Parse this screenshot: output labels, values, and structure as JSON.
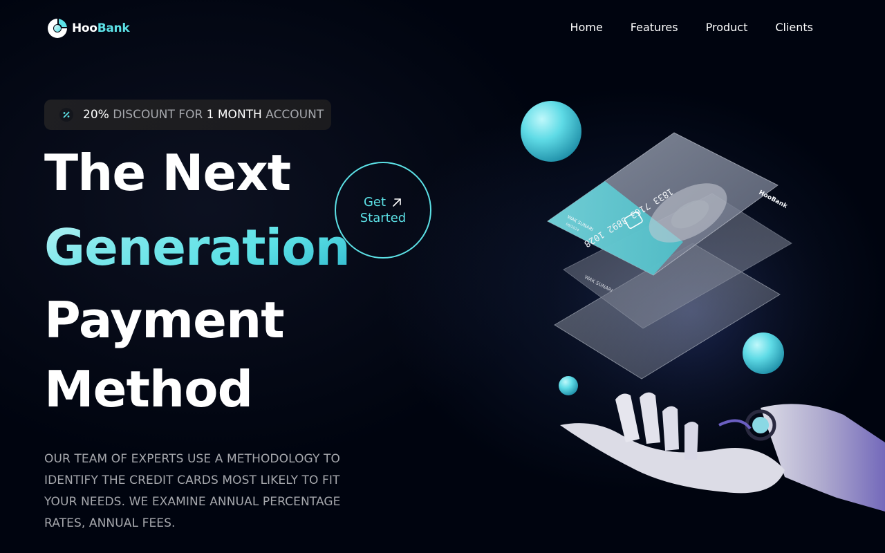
{
  "brand": {
    "name_part1": "Hoo",
    "name_part2": "Bank",
    "accent_color": "#5ce1e6",
    "background_color": "#00040f"
  },
  "nav": {
    "items": [
      {
        "label": "Home"
      },
      {
        "label": "Features"
      },
      {
        "label": "Product"
      },
      {
        "label": "Clients"
      }
    ]
  },
  "badge": {
    "icon": "discount-percent-icon",
    "value_1": "20%",
    "text_1": " DISCOUNT FOR ",
    "value_2": "1 MONTH",
    "text_2": " ACCOUNT"
  },
  "hero": {
    "line1": "The Next",
    "line2": "Generation",
    "line3": "Payment",
    "line4": "Method",
    "description": "OUR TEAM OF EXPERTS USE A METHODOLOGY TO IDENTIFY THE CREDIT CARDS MOST LIKELY TO FIT YOUR NEEDS. WE EXAMINE ANNUAL PERCENTAGE RATES, ANNUAL FEES."
  },
  "cta": {
    "line1": "Get",
    "line2": "Started",
    "icon": "arrow-up-right-icon"
  },
  "illustration": {
    "card_number": "1833 7163 3892 1028",
    "card_holder": "WAK SUNARI",
    "card_expiry": "06/2024",
    "card_brand": "HooBank"
  }
}
